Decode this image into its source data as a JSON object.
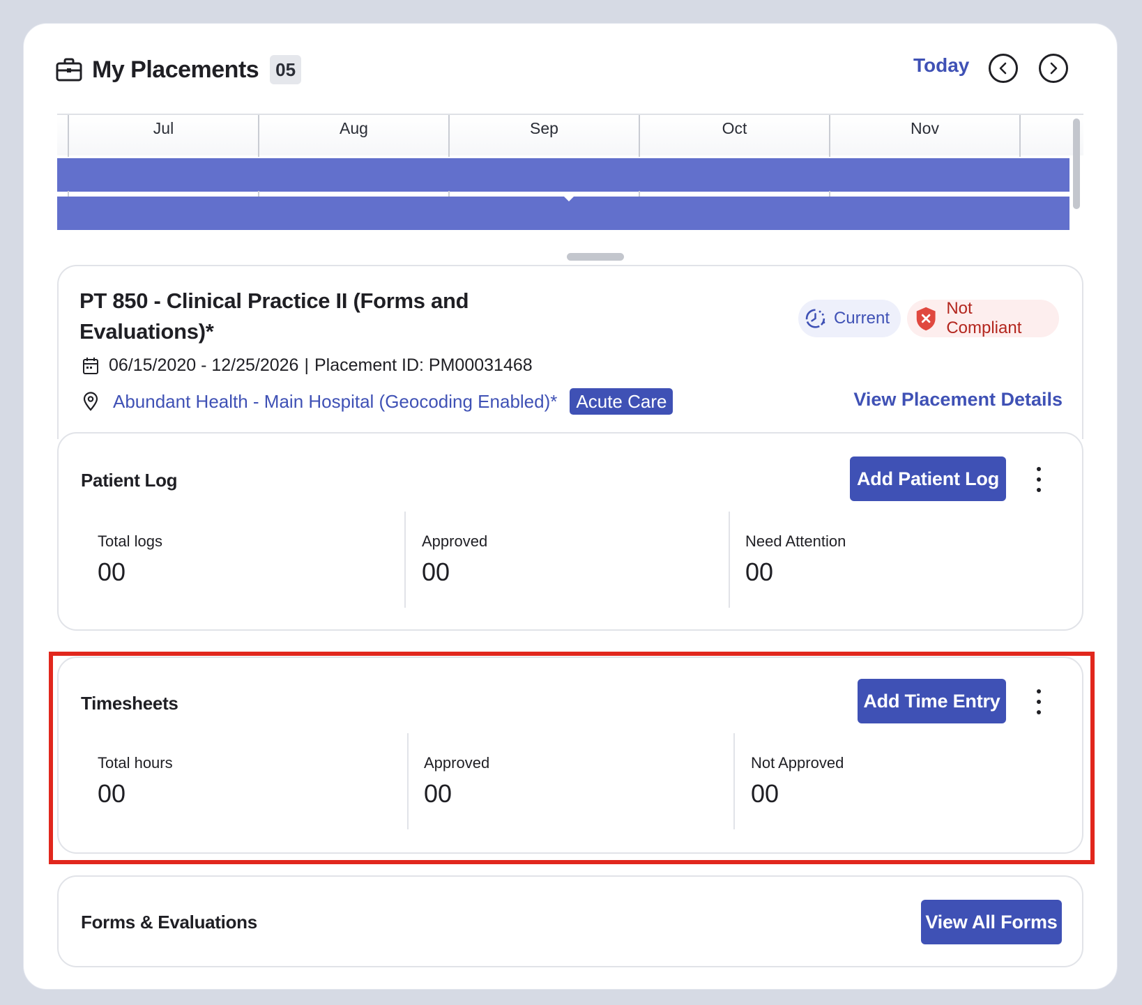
{
  "header": {
    "title": "My Placements",
    "count": "05",
    "today_label": "Today",
    "prev_icon": "chevron-left-icon",
    "next_icon": "chevron-right-icon"
  },
  "timeline": {
    "months": [
      "Jul",
      "Aug",
      "Sep",
      "Oct",
      "Nov"
    ],
    "bar_color": "#6270cc"
  },
  "placement": {
    "title": "PT 850 - Clinical Practice II (Forms and Evaluations)*",
    "dates": "06/15/2020 - 12/25/2026",
    "separator": "|",
    "placement_id": "Placement ID: PM00031468",
    "location": "Abundant Health - Main Hospital (Geocoding Enabled)*",
    "tag": "Acute Care",
    "status_current": "Current",
    "status_compliance": "Not Compliant",
    "view_details": "View Placement Details"
  },
  "patient_log": {
    "title": "Patient Log",
    "add_button": "Add Patient Log",
    "stats": [
      {
        "label": "Total logs",
        "value": "00"
      },
      {
        "label": "Approved",
        "value": "00"
      },
      {
        "label": "Need Attention",
        "value": "00"
      }
    ]
  },
  "timesheets": {
    "title": "Timesheets",
    "add_button": "Add Time Entry",
    "stats": [
      {
        "label": "Total hours",
        "value": "00"
      },
      {
        "label": "Approved",
        "value": "00"
      },
      {
        "label": "Not Approved",
        "value": "00"
      }
    ]
  },
  "forms": {
    "title": "Forms & Evaluations",
    "view_button": "View All Forms"
  },
  "colors": {
    "accent": "#3f51b5",
    "highlight": "#e1271d",
    "not_compliant": "#b3261e"
  }
}
